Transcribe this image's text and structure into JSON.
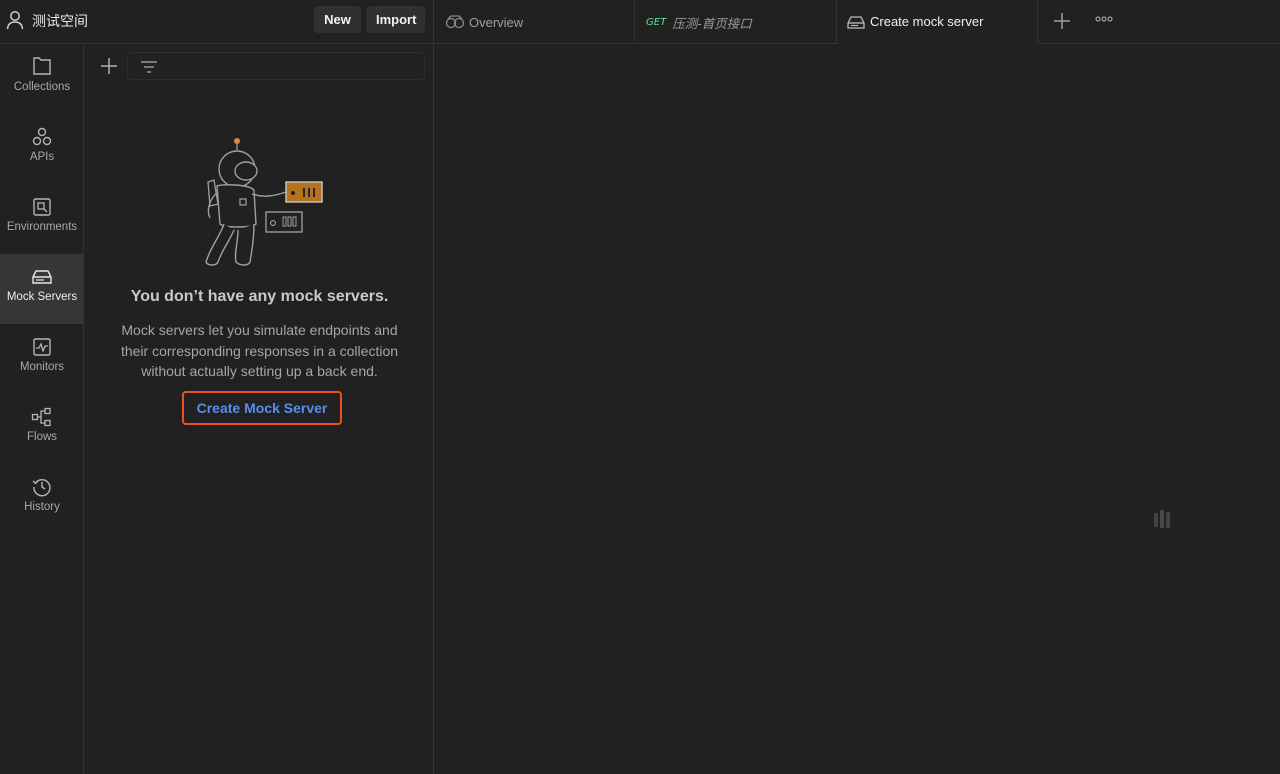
{
  "workspace": {
    "name": "测试空间",
    "new_label": "New",
    "import_label": "Import"
  },
  "tabs": [
    {
      "label": "Overview",
      "icon": "overview-icon"
    },
    {
      "method": "GET",
      "label": "压测-首页接口"
    },
    {
      "label": "Create mock server",
      "icon": "mock-server-icon"
    }
  ],
  "sidenav": {
    "items": [
      {
        "label": "Collections",
        "icon": "collections-icon"
      },
      {
        "label": "APIs",
        "icon": "apis-icon"
      },
      {
        "label": "Environments",
        "icon": "environments-icon"
      },
      {
        "label": "Mock Servers",
        "icon": "mock-servers-icon",
        "active": true
      },
      {
        "label": "Monitors",
        "icon": "monitors-icon"
      },
      {
        "label": "Flows",
        "icon": "flows-icon"
      },
      {
        "label": "History",
        "icon": "history-icon"
      }
    ]
  },
  "empty_state": {
    "title": "You don’t have any mock servers.",
    "description": "Mock servers let you simulate endpoints and their corresponding responses in a collection without actually setting up a back end.",
    "button_label": "Create Mock Server"
  },
  "colors": {
    "background": "#212121",
    "active_nav": "#363636",
    "link_blue": "#5b8cf0",
    "highlight_orange": "#e8541e",
    "get_green": "#6bdd9a"
  }
}
